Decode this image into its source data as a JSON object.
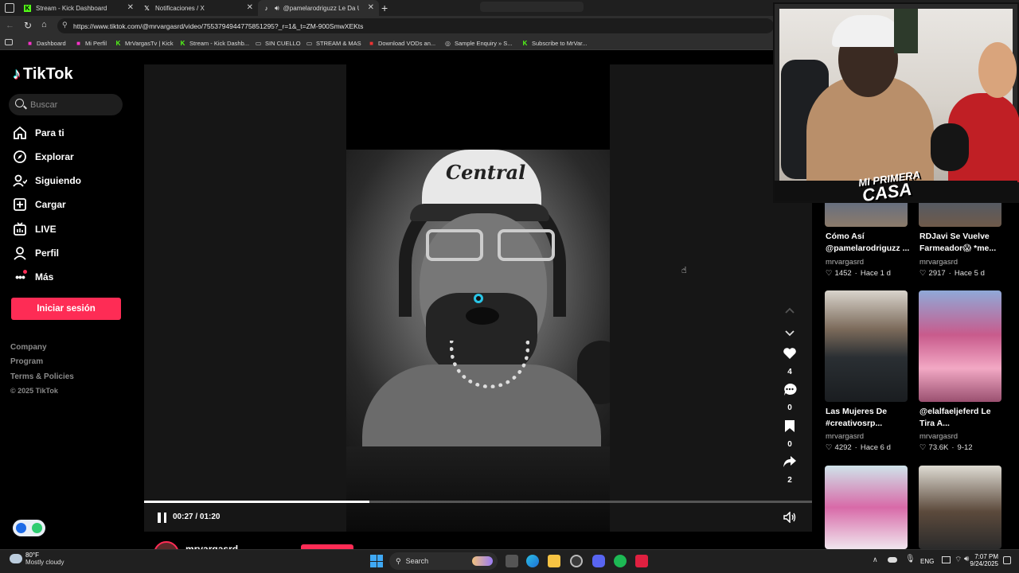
{
  "browser": {
    "tabs": [
      {
        "title": "Stream - Kick Dashboard",
        "active": false
      },
      {
        "title": "Notificaciones / X",
        "active": false
      },
      {
        "title": "@pamelarodriguzz Le Da Un",
        "active": true
      }
    ],
    "url": "https://www.tiktok.com/@mrvargasrd/video/7553794944775851295?_r=1&_t=ZM-900SmwXEKts",
    "bookmarks": [
      "Dashboard",
      "Mi Perfil",
      "MrVargasTv | Kick",
      "Stream - Kick Dashb...",
      "SIN CUELLO",
      "STREAM & MAS",
      "Download VODs an...",
      "Sample Enquiry » S...",
      "Subscribe to MrVar..."
    ]
  },
  "tiktok": {
    "brand": "TikTok",
    "search_placeholder": "Buscar",
    "nav": [
      {
        "label": "Para ti",
        "icon": "home-icon"
      },
      {
        "label": "Explorar",
        "icon": "compass-icon"
      },
      {
        "label": "Siguiendo",
        "icon": "following-icon"
      },
      {
        "label": "Cargar",
        "icon": "upload-icon"
      },
      {
        "label": "LIVE",
        "icon": "live-icon"
      },
      {
        "label": "Perfil",
        "icon": "profile-icon"
      },
      {
        "label": "Más",
        "icon": "more-icon"
      }
    ],
    "login_label": "Iniciar sesión",
    "footer": [
      "Company",
      "Program",
      "Terms & Policies"
    ],
    "copyright": "© 2025 TikTok"
  },
  "video": {
    "time": "00:27 / 01:20",
    "progress": 0.3375,
    "likes": "4",
    "comments": "0",
    "saves": "0",
    "shares": "2",
    "author": "mrvargasrd",
    "frame_text": "Central"
  },
  "recommendations": [
    {
      "title": "Cómo Así @pamelarodriguzz ...",
      "author": "mrvargasrd",
      "likes": "1452",
      "age": "Hace 1 d"
    },
    {
      "title": "RDJavi Se Vuelve Farmeador😱 *me...",
      "author": "mrvargasrd",
      "likes": "2917",
      "age": "Hace 5 d"
    },
    {
      "title": "Las Mujeres De #creativosrp...",
      "author": "mrvargasrd",
      "likes": "4292",
      "age": "Hace 6 d"
    },
    {
      "title": "@elalfaeljeferd Le Tira A...",
      "author": "mrvargasrd",
      "likes": "73.6K",
      "age": "9-12"
    }
  ],
  "overlay": {
    "banner_line1": "MI PRIMERA",
    "banner_line2": "CASA"
  },
  "taskbar": {
    "weather_temp": "80°F",
    "weather_desc": "Mostly cloudy",
    "search_label": "Search",
    "language": "ENG",
    "time": "7:07 PM",
    "date": "9/24/2025"
  },
  "colors": {
    "accent": "#fe2c55",
    "background": "#000000",
    "chrome": "#2e2e2e"
  }
}
